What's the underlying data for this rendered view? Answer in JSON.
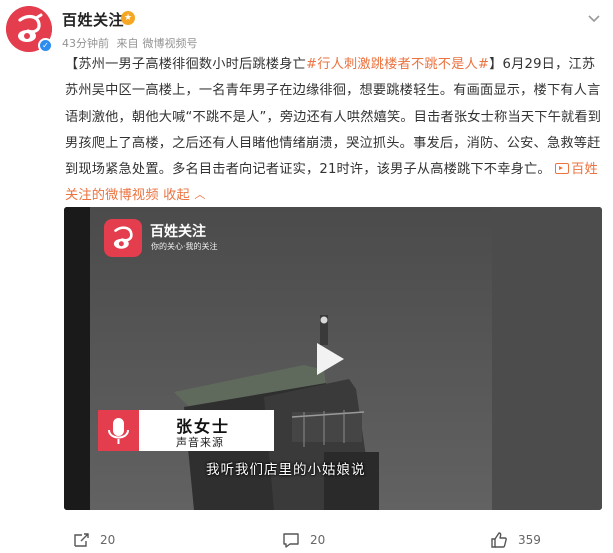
{
  "author": {
    "name": "百姓关注",
    "badge_icon": "vip-badge-icon",
    "avatar_icon": "baixing-logo-icon"
  },
  "meta": {
    "time": "43分钟前",
    "source_prefix": "来自",
    "source": "微博视频号"
  },
  "post": {
    "topic": "【苏州一男子高楼徘徊数小时后跳楼身亡",
    "hashtag": "#行人刺激跳楼者不跳不是人#",
    "body_after_hashtag": "】6月29日，江苏苏州吴中区一高楼上，一名青年男子在边缘徘徊，想要跳楼轻生。有画面显示，楼下有人言语刺激他，朝他大喊“不跳不是人”，旁边还有人哄然嬉笑。目击者张女士称当天下午就看到男孩爬上了高楼，之后还有人目睹他情绪崩溃，哭泣抓头。事发后，消防、公安、急救等赶到现场紧急处置。多名目击者向记者证实，21时许，该男子从高楼跳下不幸身亡。",
    "video_link_label": "百姓关注的微博视频",
    "collapse_label": "收起"
  },
  "video": {
    "logo_title": "百姓关注",
    "logo_subtitle": "你的关心·我的关注",
    "speaker_name": "张女士",
    "speaker_role": "声音来源",
    "subtitle": "我听我们店里的小姑娘说",
    "play_icon": "play-icon"
  },
  "actions": {
    "repost_count": "20",
    "comment_count": "20",
    "like_count": "359"
  },
  "colors": {
    "accent": "#eb7340",
    "brand_red": "#e33d4e",
    "text": "#333333",
    "meta": "#939393"
  }
}
